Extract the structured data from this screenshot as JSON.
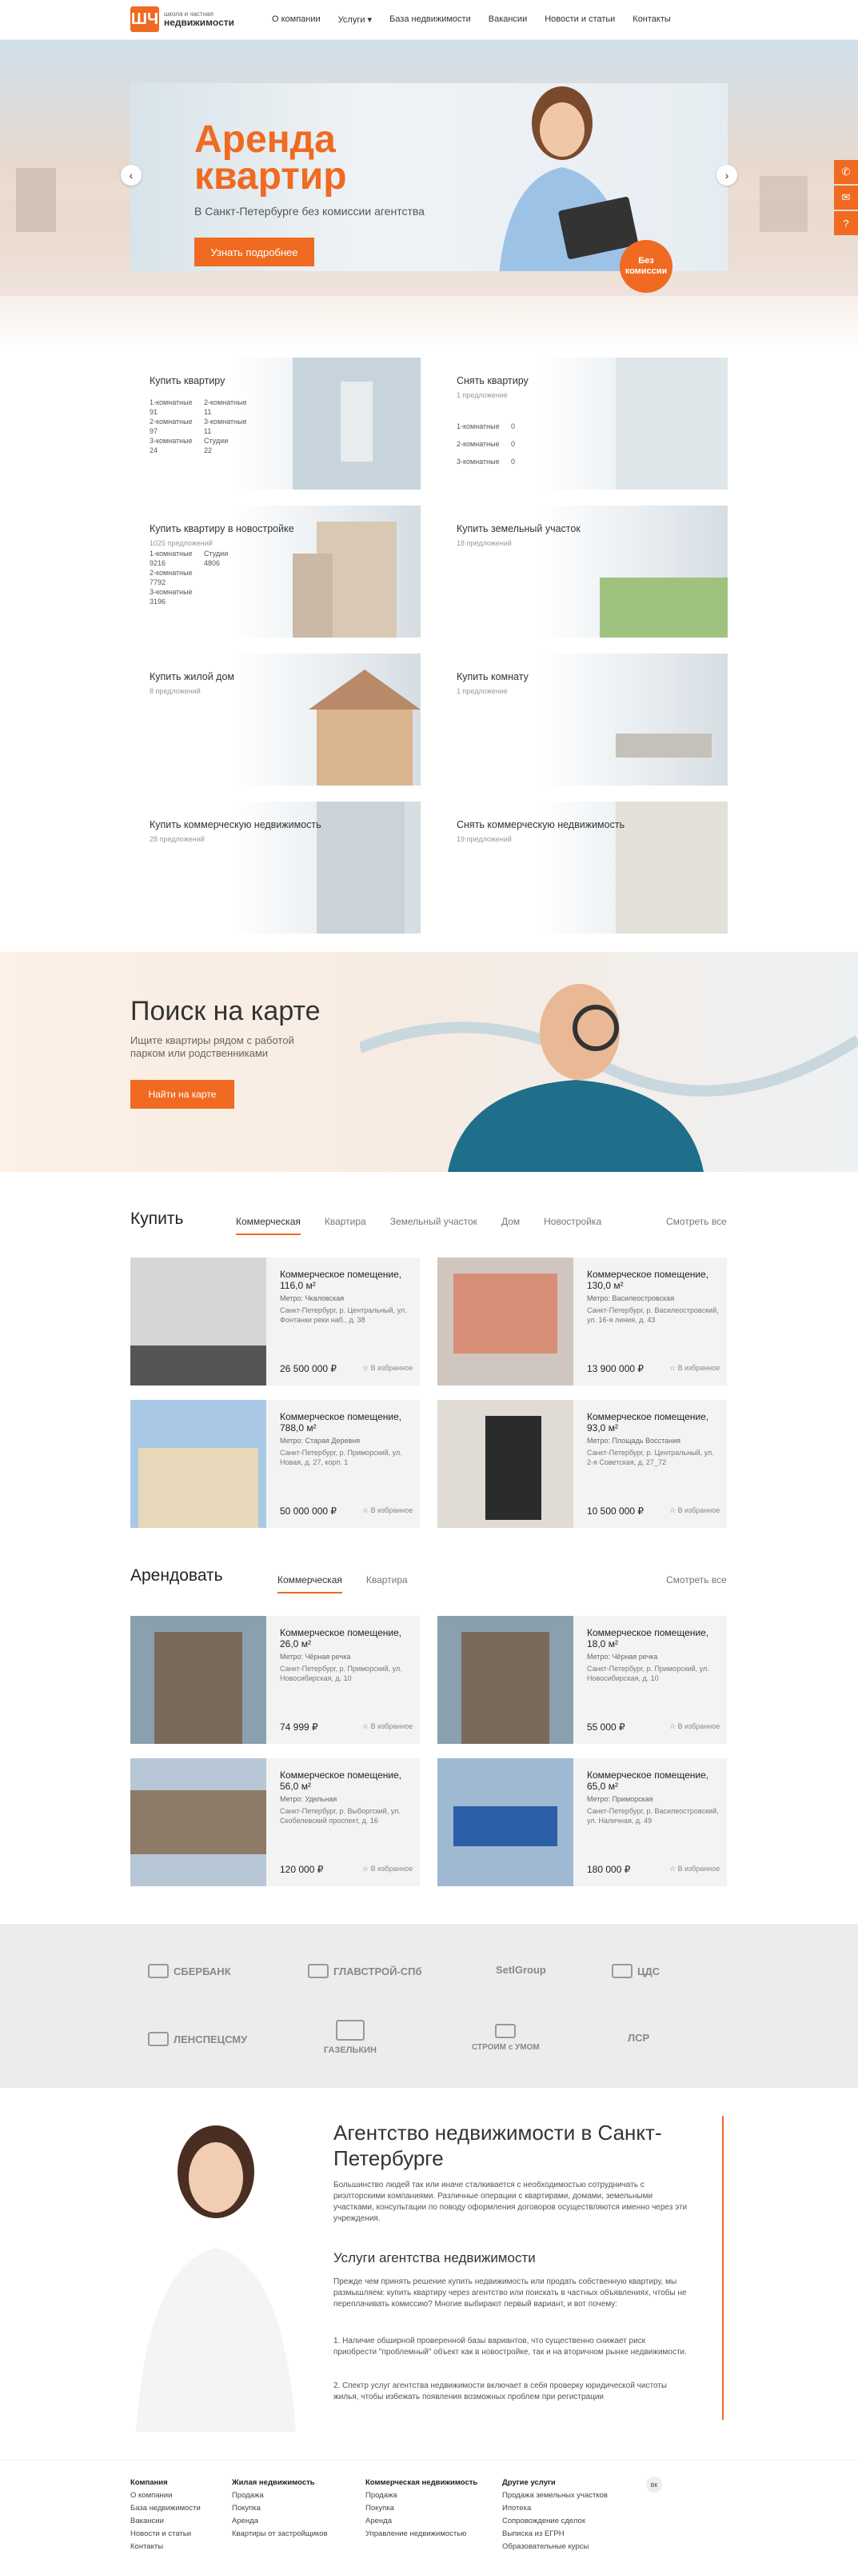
{
  "header": {
    "logo": {
      "mark": "ШЧ",
      "line1": "школа и частная",
      "line2": "недвижимости"
    },
    "nav": [
      "О компании",
      "Услуги ▾",
      "База недвижимости",
      "Вакансии",
      "Новости и статьи",
      "Контакты"
    ]
  },
  "hero": {
    "title_line1": "Аренда",
    "title_line2": "квартир",
    "subtitle": "В Санкт-Петербурге без комиссии агентства",
    "button": "Узнать подробнее",
    "badge": "Без комиссии",
    "prev": "‹",
    "next": "›"
  },
  "side_tools": [
    "✆",
    "✉",
    "?"
  ],
  "categories": [
    {
      "title": "Купить квартиру",
      "count": "",
      "links": [
        [
          "1-комнатные",
          "2-комнатные"
        ],
        [
          "91",
          "11"
        ],
        [
          "2-комнатные",
          "3-комнатные"
        ],
        [
          "97",
          "11"
        ],
        [
          "3-комнатные",
          "Студии"
        ],
        [
          "24",
          "22"
        ]
      ]
    },
    {
      "title": "Снять квартиру",
      "count": "1 предложение",
      "links": [
        [
          "1-комнатные",
          "0"
        ],
        [
          "2-комнатные",
          "0"
        ],
        [
          "3-комнатные",
          "0"
        ]
      ]
    },
    {
      "title": "Купить квартиру в новостройке",
      "count": "1025 предложений",
      "links": [
        [
          "1-комнатные",
          "Студии"
        ],
        [
          "9216",
          "4806"
        ],
        [
          "2-комнатные",
          ""
        ],
        [
          "7792",
          ""
        ],
        [
          "3-комнатные",
          ""
        ],
        [
          "3196",
          ""
        ]
      ]
    },
    {
      "title": "Купить земельный участок",
      "count": "18 предложений",
      "links": []
    },
    {
      "title": "Купить жилой дом",
      "count": "8 предложений",
      "links": []
    },
    {
      "title": "Купить комнату",
      "count": "1 предложение",
      "links": []
    },
    {
      "title": "Купить коммерческую недвижимость",
      "count": "28 предложений",
      "links": []
    },
    {
      "title": "Снять коммерческую недвижимость",
      "count": "19 предложений",
      "links": []
    }
  ],
  "map_section": {
    "title": "Поиск на карте",
    "text": "Ищите квартиры рядом с работой парком или родственниками",
    "button": "Найти на карте"
  },
  "buy": {
    "title": "Купить",
    "tabs": [
      "Коммерческая",
      "Квартира",
      "Земельный участок",
      "Дом",
      "Новостройка"
    ],
    "see_all": "Смотреть все",
    "cards": [
      {
        "title": "Коммерческое помещение, 116,0 м²",
        "metro": "Метро: Чкаловская",
        "address": "Санкт-Петербург, р. Центральный, ул. Фонтанки реки наб., д. 38",
        "price": "26 500 000 ₽",
        "fav": "☆ В избранное"
      },
      {
        "title": "Коммерческое помещение, 130,0 м²",
        "metro": "Метро: Василеостровская",
        "address": "Санкт-Петербург, р. Василеостровский, ул. 16-я линия, д. 43",
        "price": "13 900 000 ₽",
        "fav": "☆ В избранное"
      },
      {
        "title": "Коммерческое помещение, 788,0 м²",
        "metro": "Метро: Старая Деревня",
        "address": "Санкт-Петербург, р. Приморский, ул. Новая, д. 27, корп. 1",
        "price": "50 000 000 ₽",
        "fav": "☆ В избранное"
      },
      {
        "title": "Коммерческое помещение, 93,0 м²",
        "metro": "Метро: Площадь Восстания",
        "address": "Санкт-Петербург, р. Центральный, ул. 2-я Советская, д. 27_72",
        "price": "10 500 000 ₽",
        "fav": "☆ В избранное"
      }
    ]
  },
  "rent": {
    "title": "Арендовать",
    "tabs": [
      "Коммерческая",
      "Квартира"
    ],
    "see_all": "Смотреть все",
    "cards": [
      {
        "title": "Коммерческое помещение, 26,0 м²",
        "metro": "Метро: Чёрная речка",
        "address": "Санкт-Петербург, р. Приморский, ул. Новосибирская, д. 10",
        "price": "74 999 ₽",
        "fav": "☆ В избранное"
      },
      {
        "title": "Коммерческое помещение, 18,0 м²",
        "metro": "Метро: Чёрная речка",
        "address": "Санкт-Петербург, р. Приморский, ул. Новосибирская, д. 10",
        "price": "55 000 ₽",
        "fav": "☆ В избранное"
      },
      {
        "title": "Коммерческое помещение, 56,0 м²",
        "metro": "Метро: Удельная",
        "address": "Санкт-Петербург, р. Выборгский, ул. Скобелевский проспект, д. 16",
        "price": "120 000 ₽",
        "fav": "☆ В избранное"
      },
      {
        "title": "Коммерческое помещение, 65,0 м²",
        "metro": "Метро: Приморская",
        "address": "Санкт-Петербург, р. Василеостровский, ул. Наличная, д. 49",
        "price": "180 000 ₽",
        "fav": "☆ В избранное"
      }
    ]
  },
  "partners": [
    "СБЕРБАНК",
    "ГЛАВСТРОЙ-СПб",
    "SetlGroup",
    "ЦДС",
    "ЛЕНСПЕЦСМУ",
    "ГАЗЕЛЬКИН",
    "СТРОИМ с УМОМ",
    "ЛСР"
  ],
  "about": {
    "title": "Агентство недвижимости в Санкт-Петербурге",
    "p1": "Большинство людей так или иначе сталкивается с необходимостью сотрудничать с риэлторскими компаниями. Различные операции с квартирами, домами, земельными участками, консультации по поводу оформления договоров осуществляются именно через эти учреждения.",
    "h2": "Услуги агентства недвижимости",
    "p2": "Прежде чем принять решение купить недвижимость или продать собственную квартиру, мы размышляем: купить квартиру через агентство или поискать в частных объявлениях, чтобы не переплачивать комиссию? Многие выбирают первый вариант, и вот почему:",
    "li1": "1. Наличие обширной проверенной базы вариантов, что существенно снижает риск приобрести \"проблемный\" объект как в новостройке, так и на вторичном рынке недвижимости.",
    "li2": "2. Спектр услуг агентства недвижимости включает в себя проверку юридической чистоты жилья, чтобы избежать появления возможных проблем при регистрации"
  },
  "footer": {
    "cols": [
      {
        "title": "Компания",
        "items": [
          "О компании",
          "База недвижимости",
          "Вакансии",
          "Новости и статьи",
          "Контакты"
        ]
      },
      {
        "title": "Жилая недвижимость",
        "items": [
          "Продажа",
          "Покупка",
          "Аренда",
          "Квартиры от застройщиков"
        ]
      },
      {
        "title": "Коммерческая недвижимость",
        "items": [
          "Продажа",
          "Покупка",
          "Аренда",
          "Управление недвижимостью"
        ]
      },
      {
        "title": "Другие услуги",
        "items": [
          "Продажа земельных участков",
          "Ипотека",
          "Сопровождение сделок",
          "Выписка из ЕГРН",
          "Образовательные курсы"
        ]
      }
    ],
    "social": "вк"
  },
  "colors": {
    "accent": "#f06a22"
  }
}
